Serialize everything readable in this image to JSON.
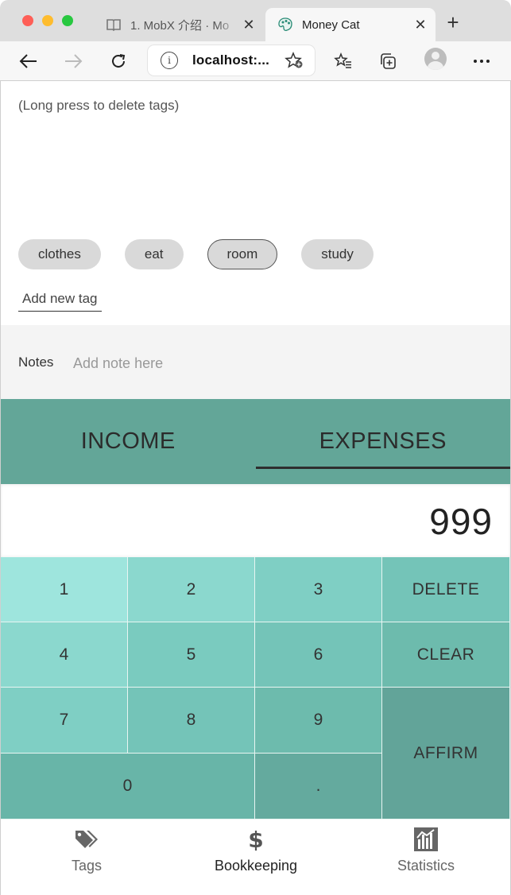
{
  "browser": {
    "tabs": [
      {
        "title": "1. MobX 介绍 · Mo",
        "icon": "book-icon",
        "active": false
      },
      {
        "title": "Money Cat",
        "icon": "palette-icon",
        "active": true
      }
    ],
    "address": "localhost:...",
    "new_tab_symbol": "+"
  },
  "tags_section": {
    "hint": "(Long press to delete tags)",
    "tags": [
      {
        "label": "clothes",
        "selected": false
      },
      {
        "label": "eat",
        "selected": false
      },
      {
        "label": "room",
        "selected": true
      },
      {
        "label": "study",
        "selected": false
      }
    ],
    "add_tag_label": "Add new tag"
  },
  "notes": {
    "label": "Notes",
    "placeholder": "Add note here",
    "value": ""
  },
  "type_tabs": {
    "income": "INCOME",
    "expenses": "EXPENSES",
    "active": "expenses"
  },
  "amount": "999",
  "keypad": {
    "k1": "1",
    "k2": "2",
    "k3": "3",
    "delete": "DELETE",
    "k4": "4",
    "k5": "5",
    "k6": "6",
    "clear": "CLEAR",
    "k7": "7",
    "k8": "8",
    "k9": "9",
    "affirm": "AFFIRM",
    "k0": "0",
    "dot": "."
  },
  "bottom_nav": {
    "tags": "Tags",
    "bookkeeping": "Bookkeeping",
    "statistics": "Statistics",
    "active": "bookkeeping"
  },
  "colors": {
    "accent": "#63a698",
    "keypad_light": "#9ee5dd",
    "keypad_dark": "#62a499"
  }
}
